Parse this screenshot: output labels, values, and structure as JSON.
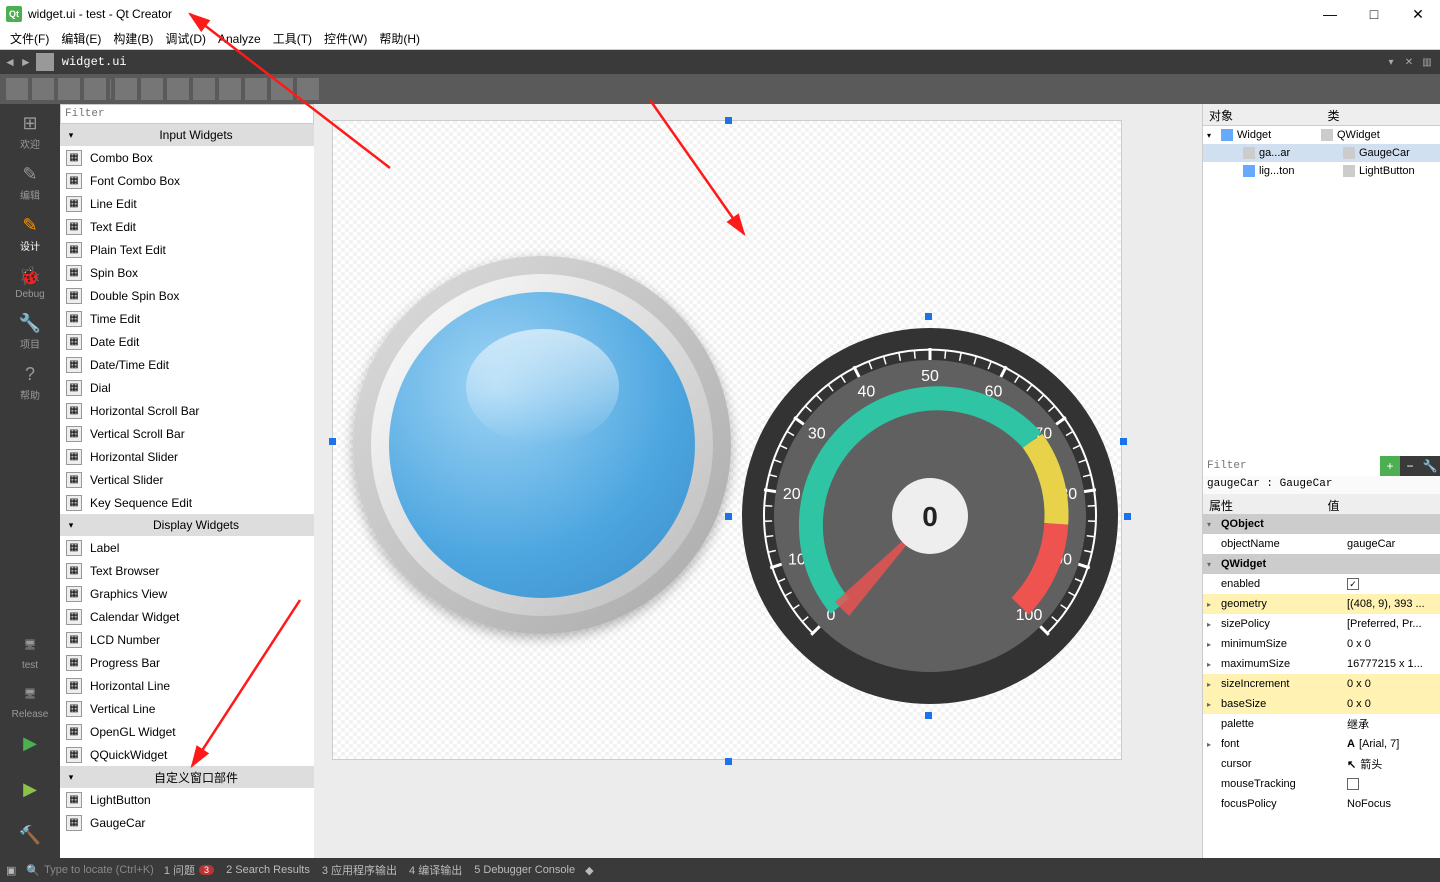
{
  "window_title": "widget.ui - test - Qt Creator",
  "menu": [
    "文件(F)",
    "编辑(E)",
    "构建(B)",
    "调试(D)",
    "Analyze",
    "工具(T)",
    "控件(W)",
    "帮助(H)"
  ],
  "tab": "widget.ui",
  "filter_placeholder": "Filter",
  "leftbar": {
    "items": [
      {
        "label": "欢迎",
        "icon": "⊞"
      },
      {
        "label": "编辑",
        "icon": "✎"
      },
      {
        "label": "设计",
        "icon": "✎",
        "active": true
      },
      {
        "label": "Debug",
        "icon": "🐞"
      },
      {
        "label": "项目",
        "icon": "🔧"
      },
      {
        "label": "帮助",
        "icon": "?"
      }
    ],
    "kit": {
      "name": "test",
      "config": "Release"
    }
  },
  "widgetbox": {
    "groups": [
      {
        "title": "Input Widgets",
        "items": [
          "Combo Box",
          "Font Combo Box",
          "Line Edit",
          "Text Edit",
          "Plain Text Edit",
          "Spin Box",
          "Double Spin Box",
          "Time Edit",
          "Date Edit",
          "Date/Time Edit",
          "Dial",
          "Horizontal Scroll Bar",
          "Vertical Scroll Bar",
          "Horizontal Slider",
          "Vertical Slider",
          "Key Sequence Edit"
        ]
      },
      {
        "title": "Display Widgets",
        "items": [
          "Label",
          "Text Browser",
          "Graphics View",
          "Calendar Widget",
          "LCD Number",
          "Progress Bar",
          "Horizontal Line",
          "Vertical Line",
          "OpenGL Widget",
          "QQuickWidget"
        ]
      },
      {
        "title": "自定义窗口部件",
        "items": [
          "LightButton",
          "GaugeCar"
        ]
      }
    ]
  },
  "gauge": {
    "value": "0",
    "min": 0,
    "max": 100,
    "ticks": [
      0,
      10,
      20,
      30,
      40,
      50,
      60,
      70,
      80,
      90,
      100
    ]
  },
  "obj_inspector": {
    "headers": [
      "对象",
      "类"
    ],
    "rows": [
      {
        "name": "Widget",
        "cls": "QWidget",
        "depth": 0,
        "expand": true
      },
      {
        "name": "ga...ar",
        "cls": "GaugeCar",
        "depth": 1,
        "sel": true
      },
      {
        "name": "lig...ton",
        "cls": "LightButton",
        "depth": 1
      }
    ]
  },
  "prop_editor": {
    "obj_label": "gaugeCar : GaugeCar",
    "headers": [
      "属性",
      "值"
    ],
    "rows": [
      {
        "k": "QObject",
        "group": true
      },
      {
        "k": "objectName",
        "v": "gaugeCar"
      },
      {
        "k": "QWidget",
        "group": true
      },
      {
        "k": "enabled",
        "v": "",
        "check": true,
        "checked": true
      },
      {
        "k": "geometry",
        "v": "[(408, 9), 393 ...",
        "yellow": true,
        "exp": true
      },
      {
        "k": "sizePolicy",
        "v": "[Preferred, Pr...",
        "exp": true
      },
      {
        "k": "minimumSize",
        "v": "0 x 0",
        "exp": true
      },
      {
        "k": "maximumSize",
        "v": "16777215 x 1...",
        "exp": true
      },
      {
        "k": "sizeIncrement",
        "v": "0 x 0",
        "yellow": true,
        "exp": true
      },
      {
        "k": "baseSize",
        "v": "0 x 0",
        "yellow": true,
        "exp": true
      },
      {
        "k": "palette",
        "v": "继承"
      },
      {
        "k": "font",
        "v": "[Arial, 7]",
        "icon": "A",
        "exp": true
      },
      {
        "k": "cursor",
        "v": "箭头",
        "icon": "↖"
      },
      {
        "k": "mouseTracking",
        "v": "",
        "check": true,
        "checked": false
      },
      {
        "k": "focusPolicy",
        "v": "NoFocus"
      }
    ]
  },
  "status": {
    "locate": "Type to locate (Ctrl+K)",
    "items": [
      {
        "n": "1",
        "t": "问题",
        "badge": "3"
      },
      {
        "n": "2",
        "t": "Search Results"
      },
      {
        "n": "3",
        "t": "应用程序输出"
      },
      {
        "n": "4",
        "t": "编译输出"
      },
      {
        "n": "5",
        "t": "Debugger Console"
      }
    ]
  }
}
